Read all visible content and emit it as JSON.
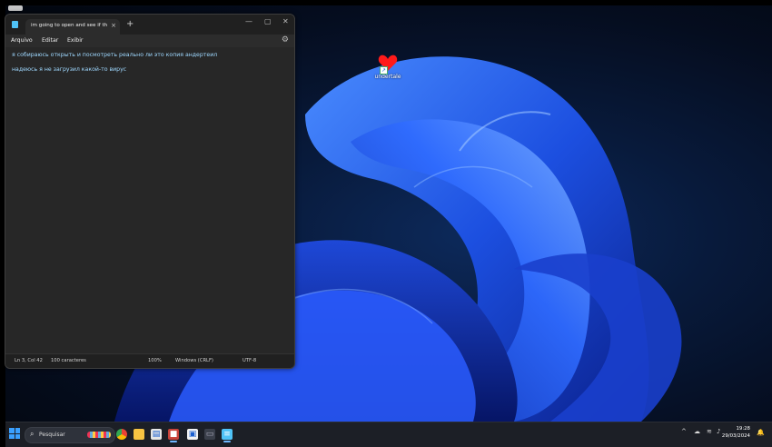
{
  "desktop": {
    "icon_label": "undertale"
  },
  "notepad": {
    "tab_title": "im going to open and see if this is",
    "tab_close": "×",
    "new_tab": "+",
    "controls": {
      "minimize": "—",
      "maximize": "▢",
      "close": "✕"
    },
    "menu": [
      "Arquivo",
      "Editar",
      "Exibir"
    ],
    "lines": [
      "я собираюсь открыть и посмотреть реально ли это копия андертеил",
      "надеюсь я не загрузил какой-то вирус"
    ],
    "status": {
      "position": "Ln 3, Col 42",
      "chars": "100 caracteres",
      "zoom": "100%",
      "line_ending": "Windows (CRLF)",
      "encoding": "UTF-8"
    }
  },
  "taskbar": {
    "search_placeholder": "Pesquisar",
    "apps": [
      "chrome",
      "file-explorer",
      "notepad-app",
      "undertale",
      "store",
      "task-view",
      "notepad"
    ],
    "time": "19:28",
    "date": "29/03/2024"
  },
  "colors": {
    "accent": "#3aa0ff",
    "text_highlight": "#9fd8ff"
  }
}
